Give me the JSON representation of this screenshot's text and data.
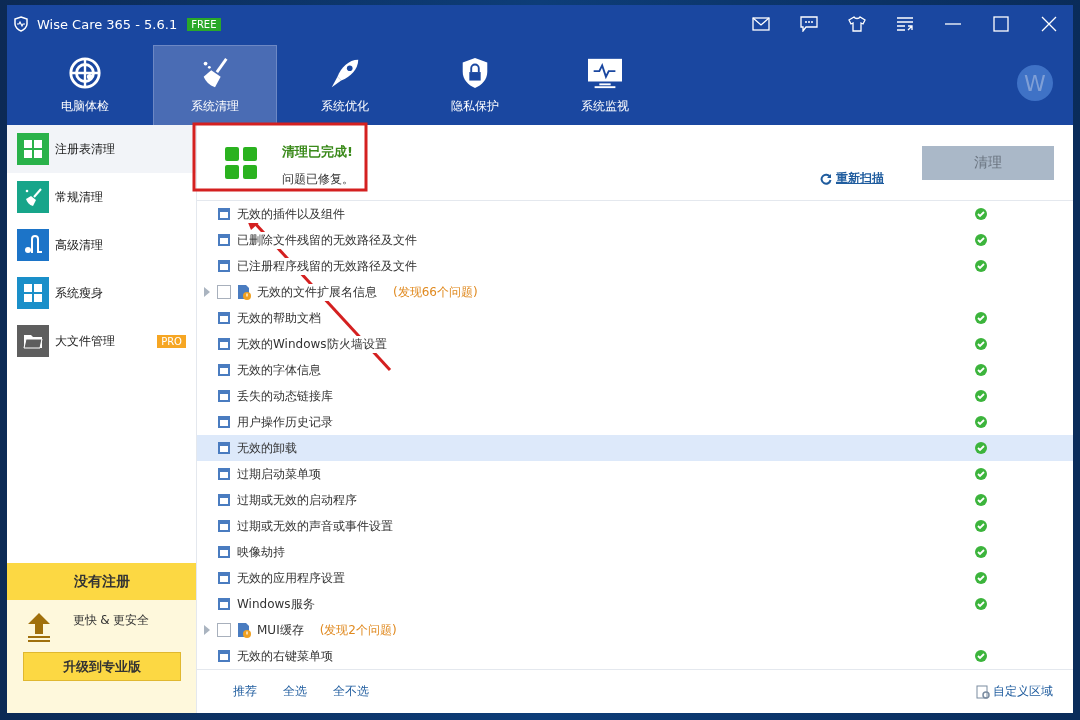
{
  "window": {
    "title": "Wise Care 365 - 5.6.1",
    "edition_badge": "FREE",
    "avatar_letter": "W"
  },
  "tabs": [
    {
      "label": "电脑体检",
      "selected": false
    },
    {
      "label": "系统清理",
      "selected": true
    },
    {
      "label": "系统优化",
      "selected": false
    },
    {
      "label": "隐私保护",
      "selected": false
    },
    {
      "label": "系统监视",
      "selected": false
    }
  ],
  "sidebar": {
    "items": [
      {
        "label": "注册表清理",
        "color": "#2ab24a",
        "selected": true
      },
      {
        "label": "常规清理",
        "color": "#17a58a",
        "selected": false
      },
      {
        "label": "高级清理",
        "color": "#1c74c8",
        "selected": false
      },
      {
        "label": "系统瘦身",
        "color": "#1a8fc9",
        "selected": false
      },
      {
        "label": "大文件管理",
        "color": "#5e5e5e",
        "selected": false,
        "badge": "PRO"
      }
    ],
    "promo": {
      "title": "没有注册",
      "tagline": "更快 & 更安全",
      "button": "升级到专业版"
    }
  },
  "result": {
    "title": "清理已完成!",
    "subtitle": "问题已修复。",
    "rescan_link": "重新扫描",
    "clean_button": "清理",
    "clean_disabled": true
  },
  "items": [
    {
      "label": "无效的插件以及组件",
      "kind": "fixed",
      "selected": false
    },
    {
      "label": "已删除文件残留的无效路径及文件",
      "kind": "fixed",
      "selected": false
    },
    {
      "label": "已注册程序残留的无效路径及文件",
      "kind": "fixed",
      "selected": false
    },
    {
      "label": "无效的文件扩展名信息",
      "kind": "issue",
      "found": "(发现66个问题)",
      "checked": false,
      "expanded": false,
      "selected": false
    },
    {
      "label": "无效的帮助文档",
      "kind": "fixed",
      "selected": false
    },
    {
      "label": "无效的Windows防火墙设置",
      "kind": "fixed",
      "selected": false
    },
    {
      "label": "无效的字体信息",
      "kind": "fixed",
      "selected": false
    },
    {
      "label": "丢失的动态链接库",
      "kind": "fixed",
      "selected": false
    },
    {
      "label": "用户操作历史记录",
      "kind": "fixed",
      "selected": false
    },
    {
      "label": "无效的卸载",
      "kind": "fixed",
      "selected": true
    },
    {
      "label": "过期启动菜单项",
      "kind": "fixed",
      "selected": false
    },
    {
      "label": "过期或无效的启动程序",
      "kind": "fixed",
      "selected": false
    },
    {
      "label": "过期或无效的声音或事件设置",
      "kind": "fixed",
      "selected": false
    },
    {
      "label": "映像劫持",
      "kind": "fixed",
      "selected": false
    },
    {
      "label": "无效的应用程序设置",
      "kind": "fixed",
      "selected": false
    },
    {
      "label": "Windows服务",
      "kind": "fixed",
      "selected": false
    },
    {
      "label": "MUI缓存",
      "kind": "issue",
      "found": "(发现2个问题)",
      "checked": false,
      "expanded": false,
      "selected": false
    },
    {
      "label": "无效的右键菜单项",
      "kind": "fixed",
      "selected": false
    }
  ],
  "footer": {
    "links": [
      "推荐",
      "全选",
      "全不选"
    ],
    "customize": "自定义区域"
  }
}
